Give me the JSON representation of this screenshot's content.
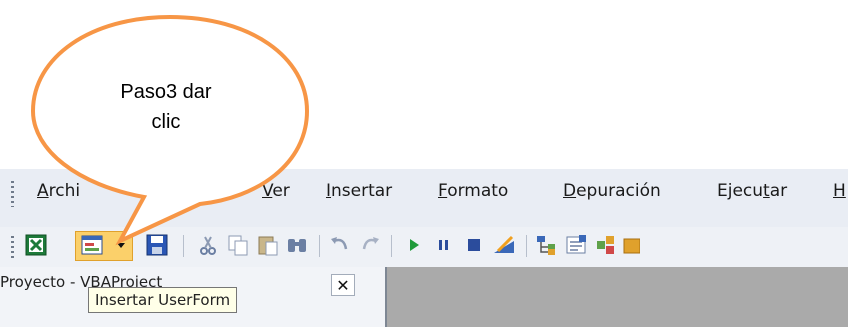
{
  "callout": {
    "text": "Paso3 dar clic",
    "line1": "Paso3 dar",
    "line2": "clic",
    "color": "#f79646"
  },
  "menu": {
    "items": [
      {
        "mn": "A",
        "rest": "rchi"
      },
      {
        "mn": "V",
        "rest": "er"
      },
      {
        "mn": "I",
        "rest": "nsertar"
      },
      {
        "mn": "F",
        "rest": "ormato"
      },
      {
        "mn": "D",
        "rest": "epuración"
      },
      {
        "pre": "Ejecu",
        "mn": "t",
        "rest": "ar"
      },
      {
        "mn": "H",
        "rest": ""
      }
    ]
  },
  "toolbar": {
    "icons": [
      "excel-icon",
      "insert-userform-icon",
      "dropdown-arrow-icon",
      "save-icon",
      "cut-icon",
      "copy-icon",
      "paste-icon",
      "find-icon",
      "undo-icon",
      "redo-icon",
      "run-icon",
      "pause-icon",
      "stop-icon",
      "design-mode-icon",
      "project-explorer-icon",
      "properties-icon",
      "object-browser-icon",
      "toolbox-icon"
    ]
  },
  "tooltip": {
    "text": "Insertar UserForm"
  },
  "project_panel": {
    "title": "Proyecto - VBAProject",
    "close": "✕"
  },
  "colors": {
    "highlight": "#fbd06a",
    "toolbar_bg": "#eef1f6",
    "menu_bg": "#e9edf4"
  }
}
